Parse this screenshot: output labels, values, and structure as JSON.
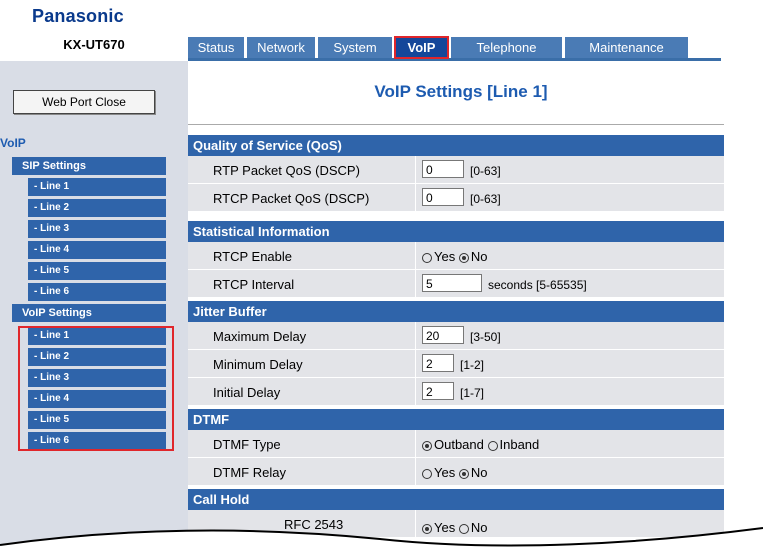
{
  "brand": "Panasonic",
  "model": "KX-UT670",
  "tabs": [
    "Status",
    "Network",
    "System",
    "VoIP",
    "Telephone",
    "Maintenance"
  ],
  "active_tab": "VoIP",
  "sidebar": {
    "web_port_close": "Web Port Close",
    "title": "VoIP",
    "sip_settings": "SIP Settings",
    "sip_lines": [
      "- Line 1",
      "- Line 2",
      "- Line 3",
      "- Line 4",
      "- Line 5",
      "- Line 6"
    ],
    "voip_settings": "VoIP Settings",
    "voip_lines": [
      "- Line 1",
      "- Line 2",
      "- Line 3",
      "- Line 4",
      "- Line 5",
      "- Line 6"
    ]
  },
  "page_title": "VoIP Settings [Line 1]",
  "qos": {
    "header": "Quality of Service (QoS)",
    "rtp_label": "RTP Packet QoS (DSCP)",
    "rtp_value": "0",
    "rtp_hint": "[0-63]",
    "rtcp_label": "RTCP Packet QoS (DSCP)",
    "rtcp_value": "0",
    "rtcp_hint": "[0-63]"
  },
  "stats": {
    "header": "Statistical Information",
    "enable_label": "RTCP Enable",
    "enable_yes": "Yes",
    "enable_no": "No",
    "enable_selected": "No",
    "interval_label": "RTCP Interval",
    "interval_value": "5",
    "interval_hint": "seconds [5-65535]"
  },
  "jitter": {
    "header": "Jitter Buffer",
    "max_label": "Maximum Delay",
    "max_value": "20",
    "max_hint": "[3-50]",
    "min_label": "Minimum Delay",
    "min_value": "2",
    "min_hint": "[1-2]",
    "init_label": "Initial Delay",
    "init_value": "2",
    "init_hint": "[1-7]"
  },
  "dtmf": {
    "header": "DTMF",
    "type_label": "DTMF Type",
    "type_out": "Outband",
    "type_in": "Inband",
    "type_selected": "Outband",
    "relay_label": "DTMF Relay",
    "relay_yes": "Yes",
    "relay_no": "No",
    "relay_selected": "No"
  },
  "hold": {
    "header": "Call Hold",
    "rfc_label": "RFC 2543",
    "rfc_yes": "Yes",
    "rfc_no": "No",
    "rfc_selected": "Yes"
  },
  "colors": {
    "brand": "#0a3a8c",
    "tab": "#4a7bb5",
    "active_tab": "#15479a",
    "highlight": "#e0262b",
    "section": "#2f64aa"
  }
}
